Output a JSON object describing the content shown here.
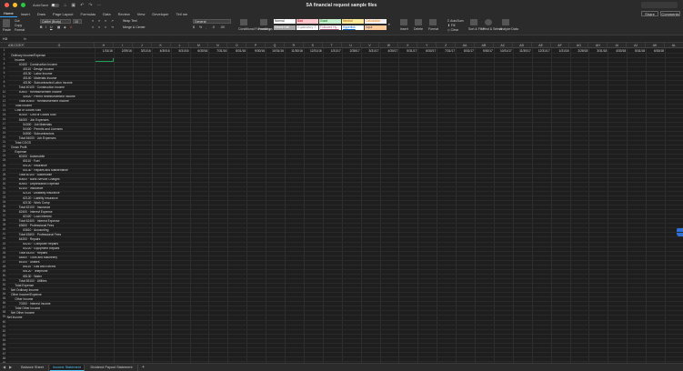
{
  "window": {
    "autosave_label": "AutoSave",
    "title": "SA financial request sample files"
  },
  "ribbon_tabs": [
    "Home",
    "Insert",
    "Draw",
    "Page Layout",
    "Formulas",
    "Data",
    "Review",
    "View",
    "Developer",
    "Tell me"
  ],
  "header_buttons": {
    "share": "Share",
    "comments": "Comments"
  },
  "ribbon": {
    "paste": "Paste",
    "cut": "Cut",
    "copy": "Copy",
    "format": "Format",
    "font_name": "Calibri (Body)",
    "font_size": "10",
    "wrap_text": "Wrap Text",
    "merge_center": "Merge & Center",
    "number_format": "General",
    "conditional_formatting": "Conditional Formatting",
    "format_as_table": "Format as Table",
    "styles": [
      "Normal",
      "Bad",
      "Good",
      "Neutral",
      "Calculation",
      "Check Cell",
      "Explanatory T...",
      "Followed Hy...",
      "Hyperlink",
      "Input"
    ],
    "insert": "Insert",
    "delete": "Delete",
    "format_cells": "Format",
    "autosum": "AutoSum",
    "fill": "Fill",
    "clear": "Clear",
    "sort_filter": "Sort & Filter",
    "find_select": "Find & Select",
    "analyze_data": "Analyze Data"
  },
  "formula_bar": {
    "name_box": "H3",
    "fx": "fx"
  },
  "columns": [
    "A",
    "B",
    "C",
    "D",
    "E",
    "F",
    "G",
    "H",
    "I",
    "J",
    "K",
    "L",
    "M",
    "N",
    "O",
    "P",
    "Q",
    "R",
    "S",
    "T",
    "U",
    "V",
    "W",
    "X",
    "Y",
    "Z",
    "AA",
    "AB",
    "AC",
    "AD",
    "AE",
    "AF",
    "AG",
    "AH",
    "AI",
    "AJ",
    "AK",
    "AL"
  ],
  "date_headers": [
    "1/31/16",
    "2/29/16",
    "3/31/16",
    "4/30/16",
    "5/31/16",
    "6/30/16",
    "7/31/16",
    "8/31/16",
    "9/30/16",
    "10/31/16",
    "11/30/16",
    "12/31/16",
    "1/31/17",
    "2/28/17",
    "3/31/17",
    "4/30/17",
    "5/31/17",
    "6/30/17",
    "7/31/17",
    "8/31/17",
    "9/30/17",
    "10/31/17",
    "11/30/17",
    "12/31/17",
    "1/31/18",
    "2/28/18",
    "3/31/18",
    "4/30/18",
    "5/31/18",
    "6/30/18"
  ],
  "row_numbers": [
    1,
    2,
    3,
    4,
    5,
    6,
    7,
    8,
    9,
    10,
    11,
    12,
    13,
    14,
    15,
    16,
    17,
    18,
    19,
    20,
    21,
    22,
    23,
    24,
    25,
    26,
    27,
    28,
    29,
    30,
    31,
    32,
    33,
    34,
    35,
    36,
    37,
    38,
    39,
    40,
    41,
    42,
    43,
    44,
    45,
    46,
    47,
    48,
    49,
    50,
    51,
    52,
    53,
    54,
    55,
    56,
    57,
    58,
    59,
    60,
    61,
    62,
    63,
    64,
    65,
    66,
    67,
    68,
    69,
    70
  ],
  "accounts": [
    {
      "row": 2,
      "indent": 0,
      "text": "Ordinary Income/Expense"
    },
    {
      "row": 3,
      "indent": 1,
      "text": "Income"
    },
    {
      "row": 4,
      "indent": 2,
      "text": "40100 · Construction Income"
    },
    {
      "row": 5,
      "indent": 3,
      "text": "40110 · Design Income"
    },
    {
      "row": 6,
      "indent": 3,
      "text": "40130 · Labor Income"
    },
    {
      "row": 7,
      "indent": 3,
      "text": "40140 · Materials Income"
    },
    {
      "row": 8,
      "indent": 3,
      "text": "40150 · Subcontracted Labor Income"
    },
    {
      "row": 9,
      "indent": 2,
      "text": "Total 40100 · Construction Income"
    },
    {
      "row": 10,
      "indent": 2,
      "text": "40500 · Reimbursement Income"
    },
    {
      "row": 11,
      "indent": 3,
      "text": "40520 · Permit Reimbursement Income"
    },
    {
      "row": 12,
      "indent": 2,
      "text": "Total 40500 · Reimbursement Income"
    },
    {
      "row": 13,
      "indent": 1,
      "text": "Total Income"
    },
    {
      "row": 14,
      "indent": 1,
      "text": "Cost of Goods Sold"
    },
    {
      "row": 15,
      "indent": 2,
      "text": "50100 · Cost of Goods Sold"
    },
    {
      "row": 16,
      "indent": 2,
      "text": "54000 · Job Expenses"
    },
    {
      "row": 17,
      "indent": 3,
      "text": "54300 · Job Materials"
    },
    {
      "row": 18,
      "indent": 3,
      "text": "54400 · Permits and Licenses"
    },
    {
      "row": 19,
      "indent": 3,
      "text": "54500 · Subcontractors"
    },
    {
      "row": 20,
      "indent": 2,
      "text": "Total 54000 · Job Expenses"
    },
    {
      "row": 21,
      "indent": 1,
      "text": "Total COGS"
    },
    {
      "row": 22,
      "indent": 0,
      "text": "Gross Profit"
    },
    {
      "row": 23,
      "indent": 1,
      "text": "Expense"
    },
    {
      "row": 24,
      "indent": 2,
      "text": "60100 · Automobile"
    },
    {
      "row": 25,
      "indent": 3,
      "text": "60110 · Fuel"
    },
    {
      "row": 26,
      "indent": 3,
      "text": "60120 · Insurance"
    },
    {
      "row": 27,
      "indent": 3,
      "text": "60130 · Repairs and Maintenance"
    },
    {
      "row": 28,
      "indent": 2,
      "text": "Total 60100 · Automobile"
    },
    {
      "row": 29,
      "indent": 2,
      "text": "60600 · Bank Service Charges"
    },
    {
      "row": 30,
      "indent": 2,
      "text": "60900 · Depreciation Expense"
    },
    {
      "row": 31,
      "indent": 2,
      "text": "62100 · Insurance"
    },
    {
      "row": 32,
      "indent": 3,
      "text": "62110 · Disability Insurance"
    },
    {
      "row": 33,
      "indent": 3,
      "text": "62120 · Liability Insurance"
    },
    {
      "row": 34,
      "indent": 3,
      "text": "62130 · Work Comp"
    },
    {
      "row": 35,
      "indent": 2,
      "text": "Total 62100 · Insurance"
    },
    {
      "row": 36,
      "indent": 2,
      "text": "62400 · Interest Expense"
    },
    {
      "row": 37,
      "indent": 3,
      "text": "62420 · Loan Interest"
    },
    {
      "row": 38,
      "indent": 2,
      "text": "Total 62400 · Interest Expense"
    },
    {
      "row": 39,
      "indent": 2,
      "text": "63600 · Professional Fees"
    },
    {
      "row": 40,
      "indent": 3,
      "text": "63610 · Accounting"
    },
    {
      "row": 41,
      "indent": 2,
      "text": "Total 63600 · Professional Fees"
    },
    {
      "row": 42,
      "indent": 2,
      "text": "64200 · Repairs"
    },
    {
      "row": 43,
      "indent": 3,
      "text": "64210 · Computer Repairs"
    },
    {
      "row": 44,
      "indent": 3,
      "text": "64220 · Equipment Repairs"
    },
    {
      "row": 45,
      "indent": 2,
      "text": "Total 64200 · Repairs"
    },
    {
      "row": 46,
      "indent": 2,
      "text": "64800 · Tools and Machinery"
    },
    {
      "row": 47,
      "indent": 2,
      "text": "65100 · Utilities"
    },
    {
      "row": 48,
      "indent": 3,
      "text": "65110 · Gas and Electric"
    },
    {
      "row": 49,
      "indent": 3,
      "text": "65120 · Telephone"
    },
    {
      "row": 50,
      "indent": 3,
      "text": "65130 · Water"
    },
    {
      "row": 51,
      "indent": 2,
      "text": "Total 65100 · Utilities"
    },
    {
      "row": 52,
      "indent": 1,
      "text": "Total Expense"
    },
    {
      "row": 53,
      "indent": 0,
      "text": "Net Ordinary Income"
    },
    {
      "row": 54,
      "indent": 0,
      "text": "Other Income/Expense"
    },
    {
      "row": 55,
      "indent": 1,
      "text": "Other Income"
    },
    {
      "row": 56,
      "indent": 2,
      "text": "70200 · Interest Income"
    },
    {
      "row": 57,
      "indent": 1,
      "text": "Total Other Income"
    },
    {
      "row": 58,
      "indent": 0,
      "text": "Net Other Income"
    },
    {
      "row": 59,
      "indent": -1,
      "text": "Net Income"
    }
  ],
  "sheet_tabs": [
    {
      "label": "Balance Sheet",
      "active": false
    },
    {
      "label": "Income Statement",
      "active": true
    },
    {
      "label": "Dividend Payout Statement",
      "active": false
    }
  ],
  "colors": {
    "style_normal": "#ffffff",
    "style_bad": "#ffc7ce",
    "style_good": "#c6efce",
    "style_neutral": "#ffeb9c",
    "style_calculation": "#f2f2f2",
    "style_check_cell": "#a5a5a5",
    "style_explanatory": "#ffffff",
    "style_followed": "#ffffff",
    "style_hyperlink": "#ffffff",
    "style_input": "#ffcc99",
    "active_tab": "#2ea4ff",
    "selection": "#1f9d55"
  }
}
